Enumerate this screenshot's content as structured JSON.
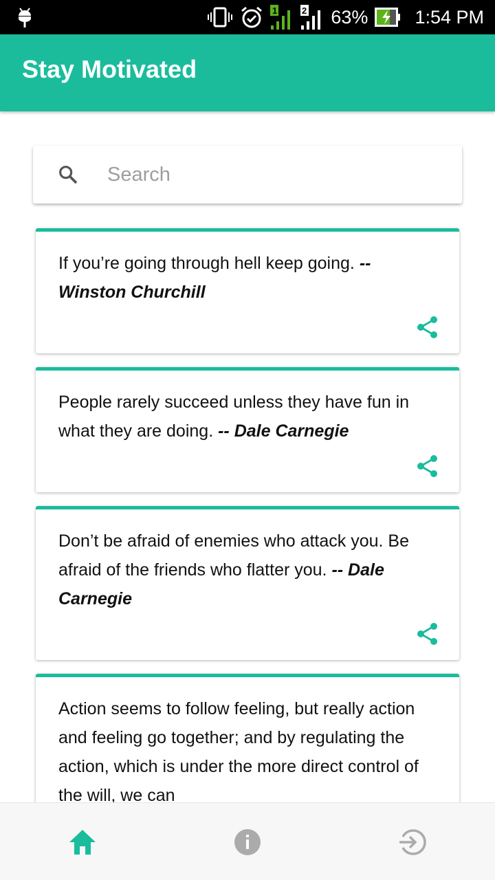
{
  "status_bar": {
    "battery": "63%",
    "time": "1:54 PM",
    "sim1": "1",
    "sim2": "2"
  },
  "app_bar": {
    "title": "Stay Motivated"
  },
  "search": {
    "placeholder": "Search",
    "value": ""
  },
  "quotes": [
    {
      "text": "If you’re going through hell keep going.",
      "author": "-- Winston Churchill"
    },
    {
      "text": "People rarely succeed unless they have fun in what they are doing.",
      "author": "-- Dale Carnegie"
    },
    {
      "text": "Don’t be afraid of enemies who attack you. Be afraid of the friends who flatter you.",
      "author": "-- Dale Carnegie"
    },
    {
      "text": "Action seems to follow feeling, but really action and feeling go together; and by regulating the action, which is under the more direct control of the will, we can",
      "author": ""
    }
  ],
  "bottom_nav": {
    "items": [
      {
        "icon": "home-icon",
        "active": true
      },
      {
        "icon": "info-icon",
        "active": false
      },
      {
        "icon": "logout-icon",
        "active": false
      }
    ]
  },
  "colors": {
    "accent": "#1abc9c",
    "inactive": "#ababab"
  }
}
